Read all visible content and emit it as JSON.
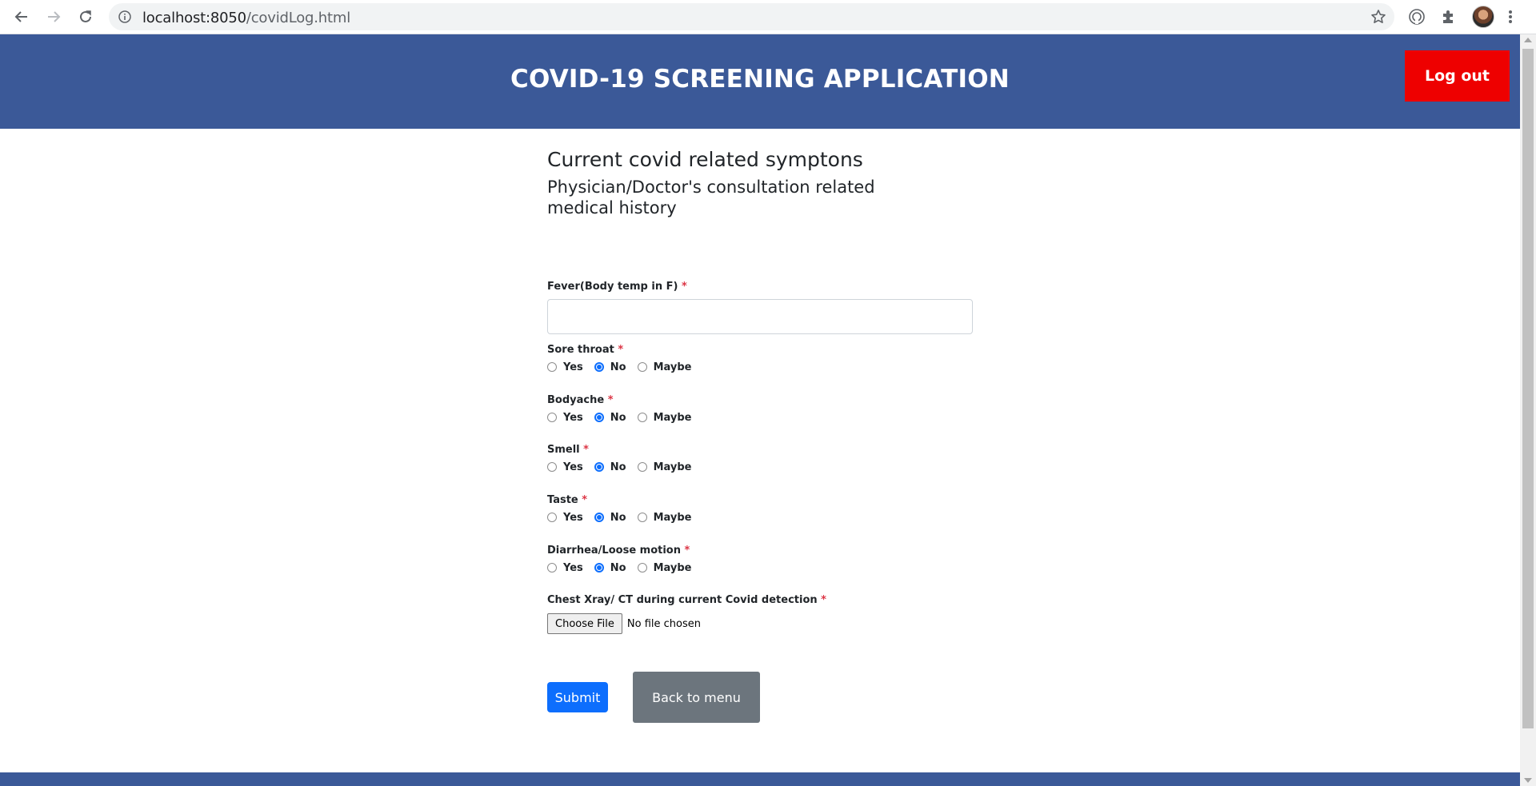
{
  "browser": {
    "url_host": "localhost:8050",
    "url_path": "/covidLog.html",
    "icons": [
      "back-arrow-icon",
      "forward-arrow-icon",
      "reload-icon",
      "info-icon",
      "star-icon",
      "profile-extension-icon",
      "puzzle-icon",
      "avatar",
      "kebab-menu-icon"
    ]
  },
  "header": {
    "title": "COVID-19 SCREENING APPLICATION",
    "logout_label": "Log out",
    "background": "#3b5998",
    "logout_color": "#ee0000"
  },
  "form": {
    "heading": "Current covid related symptons",
    "subheading": "Physician/Doctor's consultation related medical history",
    "fever_label": "Fever(Body temp in F)",
    "fever_value": "",
    "required_mark": "*",
    "radio_options": [
      "Yes",
      "No",
      "Maybe"
    ],
    "questions": [
      {
        "label": "Sore throat",
        "selected": "No"
      },
      {
        "label": "Bodyache",
        "selected": "No"
      },
      {
        "label": "Smell",
        "selected": "No"
      },
      {
        "label": "Taste",
        "selected": "No"
      },
      {
        "label": "Diarrhea/Loose motion",
        "selected": "No"
      }
    ],
    "xray_label": "Chest Xray/ CT during current Covid detection",
    "file_button": "Choose File",
    "file_status": "No file chosen",
    "submit_label": "Submit",
    "back_label": "Back to menu"
  }
}
